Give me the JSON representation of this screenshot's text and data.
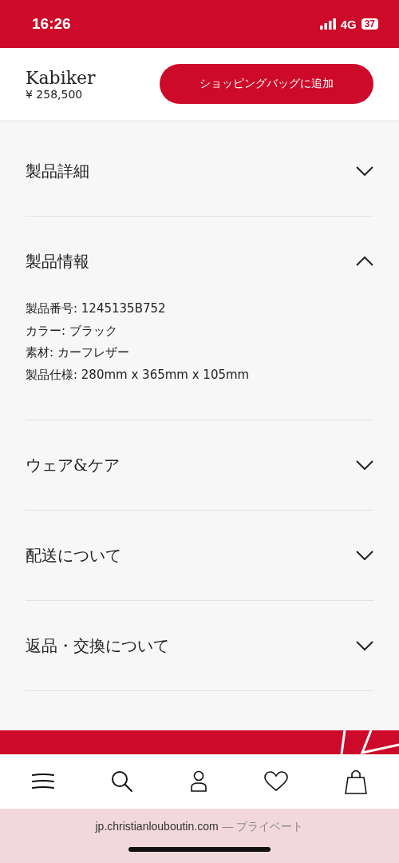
{
  "status_bar": {
    "time": "16:26",
    "network": "4G",
    "battery": "37"
  },
  "product": {
    "name": "Kabiker",
    "price": "¥ 258,500",
    "add_button": "ショッピングバッグに追加"
  },
  "sections": [
    {
      "title": "製品詳細",
      "expanded": false
    },
    {
      "title": "製品情報",
      "expanded": true,
      "lines": [
        "製品番号: 1245135B752",
        "カラー: ブラック",
        "素材: カーフレザー",
        "製品仕様: 280mm x 365mm x 105mm"
      ]
    },
    {
      "title": "ウェア&ケア",
      "expanded": false
    },
    {
      "title": "配送について",
      "expanded": false
    },
    {
      "title": "返品・交換について",
      "expanded": false
    }
  ],
  "bottom_nav": [
    {
      "kind": "menu"
    },
    {
      "kind": "search"
    },
    {
      "kind": "account"
    },
    {
      "kind": "wishlist"
    },
    {
      "kind": "bag"
    }
  ],
  "browser_bar": {
    "domain": "jp.christianlouboutin.com",
    "mode": "— プライベート"
  }
}
